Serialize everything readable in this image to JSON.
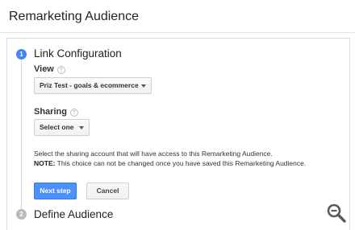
{
  "page": {
    "title": "Remarketing Audience"
  },
  "steps": [
    {
      "number": "1",
      "title": "Link Configuration",
      "state": "active",
      "color": "#4285f4"
    },
    {
      "number": "2",
      "title": "Define Audience",
      "state": "inactive",
      "color": "#b9b9b9"
    }
  ],
  "view": {
    "label": "View",
    "help": "?",
    "selected": "Priz Test - goals & ecommerce"
  },
  "sharing": {
    "label": "Sharing",
    "help": "?",
    "selected": "Select one"
  },
  "description": {
    "line1": "Select the sharing account that will have access to this Remarketing Audience.",
    "note_label": "NOTE:",
    "note_text": " This choice can not be changed once you have saved this Remarketing Audience."
  },
  "buttons": {
    "next": "Next step",
    "cancel": "Cancel"
  },
  "colors": {
    "primary": "#4d90fe",
    "accent": "#4285f4"
  },
  "icons": {
    "zoom": "magnifier-zoom-icon",
    "dropdown": "caret-down-icon",
    "help": "question-circle-icon"
  }
}
